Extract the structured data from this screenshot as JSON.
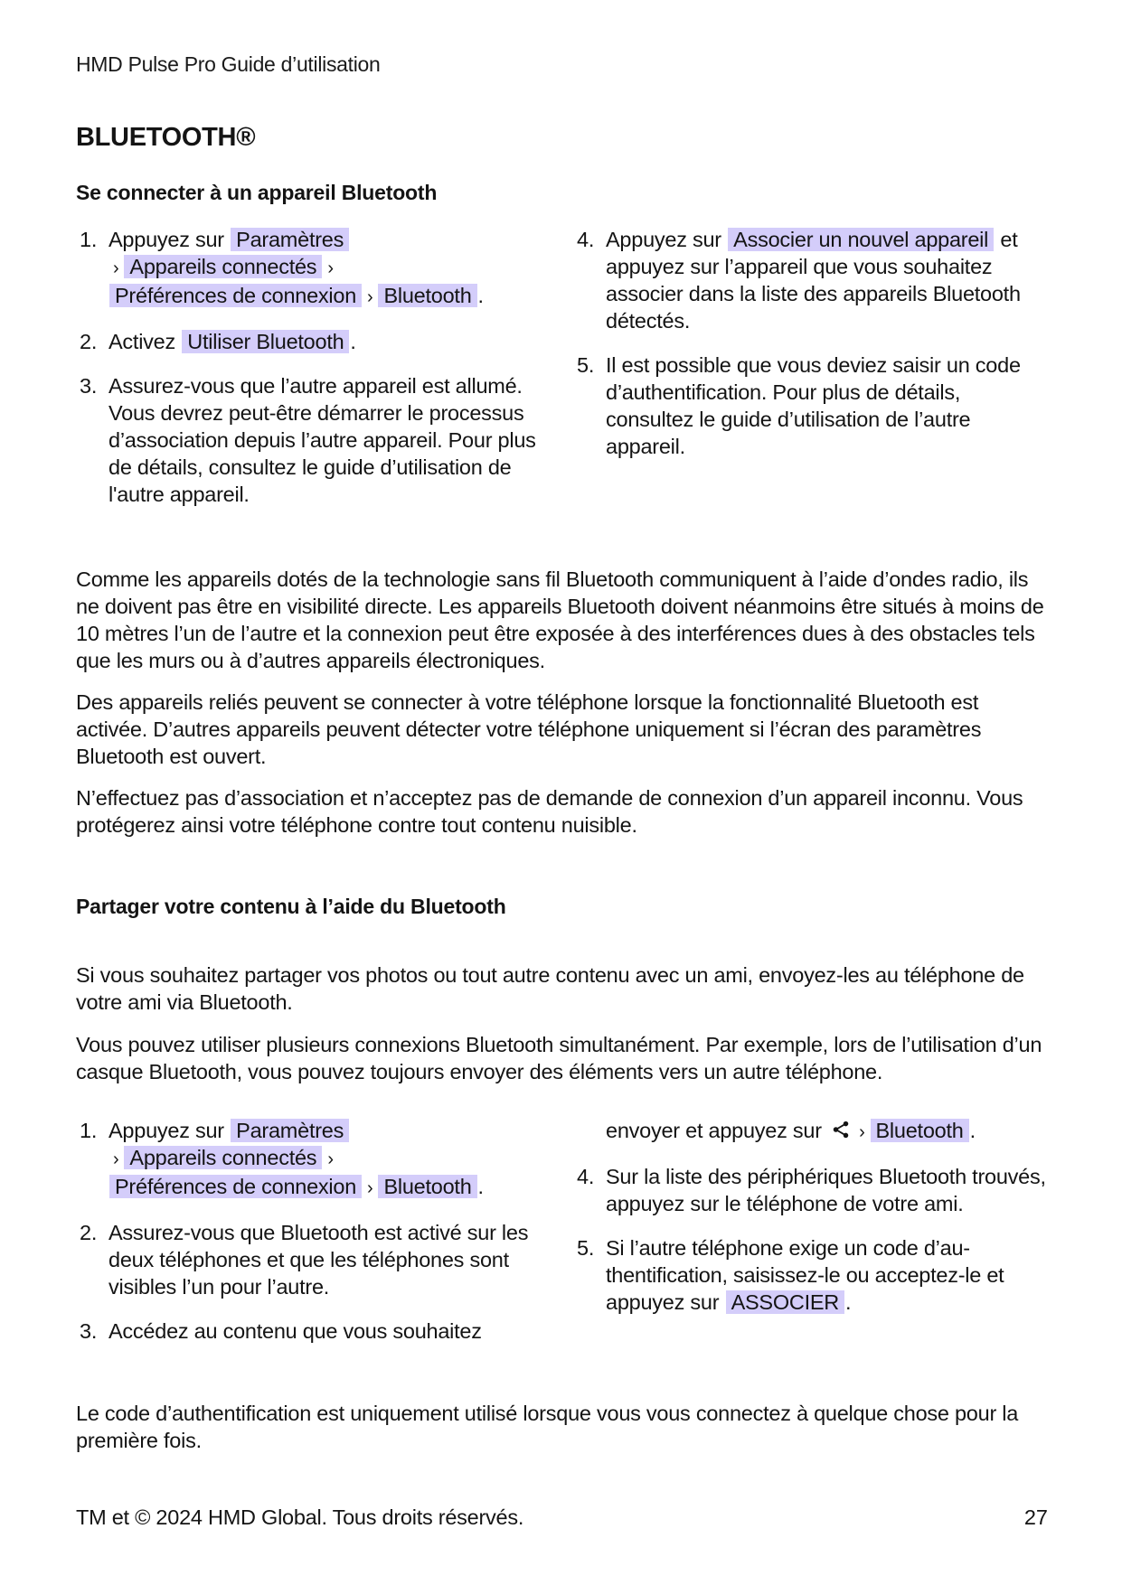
{
  "header": {
    "running_title": "HMD Pulse Pro Guide d’utilisation"
  },
  "section": {
    "title": "BLUETOOTH®"
  },
  "connect": {
    "title": "Se connecter à un appareil Bluetooth",
    "steps": {
      "s1": {
        "num": "1.",
        "prefix": "Appuyez sur",
        "p1": "Paramètres",
        "sep1": "›",
        "p2": "Appareils connectés",
        "sep2": "›",
        "p3": "Préférences de connexion",
        "sep3": "›",
        "p4": "Bluetooth",
        "end": "."
      },
      "s2": {
        "num": "2.",
        "prefix": "Activez",
        "p1": "Utiliser Bluetooth",
        "end": "."
      },
      "s3": {
        "num": "3.",
        "text": "Assurez-vous que l’autre appareil est al­lumé. Vous devrez peut-être démarrer le processus d’association depuis l’autre ap­pareil. Pour plus de détails, consultez le guide d’utilisation de l'autre appareil."
      },
      "s4": {
        "num": "4.",
        "prefix": "Appuyez sur",
        "p1": "Associer un nouvel appareil",
        "suffix": "et appuyez sur l’appareil que vous souhaitez associer dans la liste des ap­pareils Bluetooth détectés."
      },
      "s5": {
        "num": "5.",
        "text": "Il est possible que vous deviez saisir un code d’authentification. Pour plus de dé­tails, consultez le guide d’utilisation de l’autre appareil."
      }
    },
    "paragraphs": [
      "Comme les appareils dotés de la technologie sans fil Bluetooth communiquent à l’aide d’on­des radio, ils ne doivent pas être en visibilité directe. Les appareils Bluetooth doivent néan­moins être situés à moins de 10 mètres l’un de l’autre et la connexion peut être exposée à des interférences dues à des obstacles tels que les murs ou à d’autres appareils électroniques.",
      "Des appareils reliés peuvent se connecter à votre téléphone lorsque la fonctionnalité Blue­tooth est activée. D’autres appareils peuvent détecter votre téléphone uniquement si l’écran des paramètres Bluetooth est ouvert.",
      "N’effectuez pas d’association et n’acceptez pas de demande de connexion d’un appareil in­connu. Vous protégerez ainsi votre téléphone contre tout contenu nuisible."
    ]
  },
  "share": {
    "title": "Partager votre contenu à l’aide du Bluetooth",
    "paragraphs": [
      "Si vous souhaitez partager vos photos ou tout autre contenu avec un ami, envoyez-les au téléphone de votre ami via Bluetooth.",
      "Vous pouvez utiliser plusieurs connexions Bluetooth simultanément. Par exemple, lors de l’utilisation d’un casque Bluetooth, vous pouvez toujours envoyer des éléments vers un autre téléphone."
    ],
    "steps": {
      "s1": {
        "num": "1.",
        "prefix": "Appuyez sur",
        "p1": "Paramètres",
        "sep1": "›",
        "p2": "Appareils connectés",
        "sep2": "›",
        "p3": "Préférences de connexion",
        "sep3": "›",
        "p4": "Bluetooth",
        "end": "."
      },
      "s2": {
        "num": "2.",
        "text": "Assurez-vous que Bluetooth est activé sur les deux téléphones et que les télé­phones sont visibles l’un pour l’autre."
      },
      "s3": {
        "num": "3.",
        "text_a": "Accédez au contenu que vous souhaitez",
        "text_b": "envoyer et appuyez sur",
        "icon": "share-icon",
        "sep": "›",
        "p1": "Bluetooth",
        "end": "."
      },
      "s4": {
        "num": "4.",
        "text": "Sur la liste des périphériques Bluetooth trouvés, appuyez sur le téléphone de votre ami."
      },
      "s5": {
        "num": "5.",
        "text": "Si l’autre téléphone exige un code d’au­thentification, saisissez-le ou acceptez-le et appuyez sur",
        "p1": "ASSOCIER",
        "end": "."
      }
    },
    "closing": "Le code d’authentification est uniquement utilisé lorsque vous vous connectez à quelque chose pour la première fois."
  },
  "footer": {
    "copyright": "TM et © 2024 HMD Global. Tous droits réservés.",
    "page_number": "27"
  },
  "colors": {
    "highlight": "#d4cdfa",
    "text": "#141414"
  }
}
